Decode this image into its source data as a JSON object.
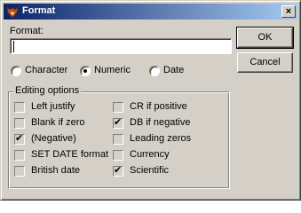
{
  "window": {
    "title": "Format",
    "close_glyph": "×"
  },
  "format_field": {
    "label": "Format:",
    "value": ""
  },
  "buttons": {
    "ok": "OK",
    "cancel": "Cancel"
  },
  "type_options": [
    {
      "label": "Character",
      "selected": false
    },
    {
      "label": "Numeric",
      "selected": true
    },
    {
      "label": "Date",
      "selected": false
    }
  ],
  "editing_options": {
    "title": "Editing options",
    "left_column": [
      {
        "label": "Left justify",
        "checked": false
      },
      {
        "label": "Blank if zero",
        "checked": false
      },
      {
        "label": "(Negative)",
        "checked": true
      },
      {
        "label": "SET DATE format",
        "checked": false
      },
      {
        "label": "British date",
        "checked": false
      }
    ],
    "right_column": [
      {
        "label": "CR if positive",
        "checked": false
      },
      {
        "label": "DB if negative",
        "checked": true
      },
      {
        "label": "Leading zeros",
        "checked": false
      },
      {
        "label": "Currency",
        "checked": false
      },
      {
        "label": "Scientific",
        "checked": true
      }
    ]
  },
  "icons": {
    "app": "foxpro-fox-icon",
    "close": "close-icon"
  }
}
